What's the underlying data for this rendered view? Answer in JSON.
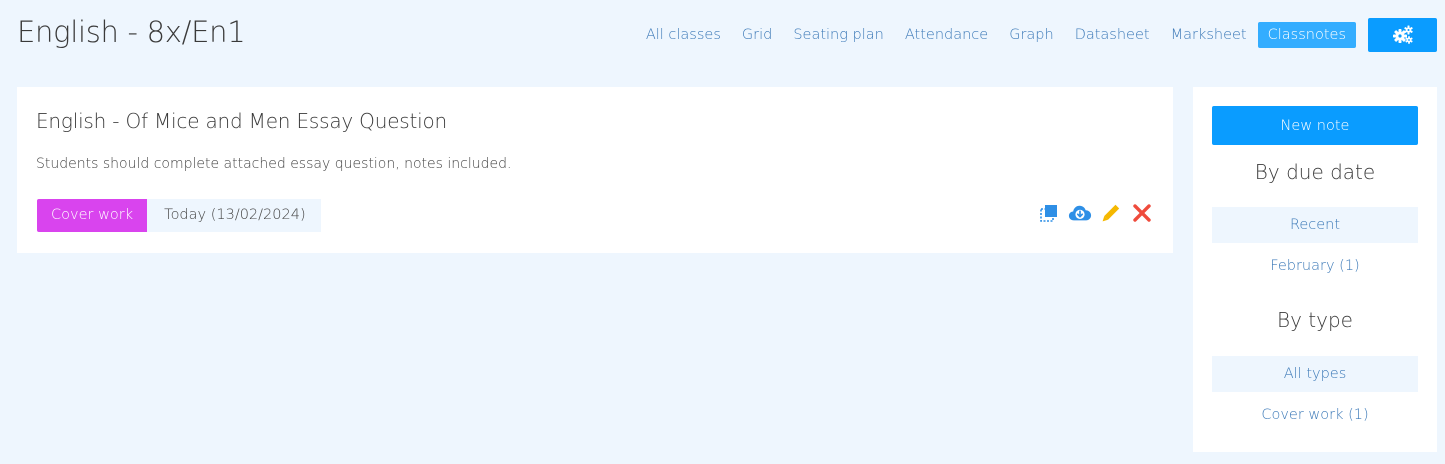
{
  "header": {
    "class_title": "English - 8x/En1",
    "nav": [
      {
        "label": "All classes"
      },
      {
        "label": "Grid"
      },
      {
        "label": "Seating plan"
      },
      {
        "label": "Attendance"
      },
      {
        "label": "Graph"
      },
      {
        "label": "Datasheet"
      },
      {
        "label": "Marksheet"
      },
      {
        "label": "Classnotes",
        "active": true
      }
    ],
    "settings_icon": "gears-icon"
  },
  "note": {
    "title": "English - Of Mice and Men Essay Question",
    "body": "Students should complete attached essay question, notes included.",
    "type_label": "Cover work",
    "date_label": "Today (13/02/2024)",
    "actions": [
      "copy-icon",
      "cloud-download-icon",
      "pencil-icon",
      "delete-icon"
    ]
  },
  "sidebar": {
    "new_note_label": "New note",
    "by_due_date_heading": "By due date",
    "due_filters": [
      {
        "label": "Recent",
        "selected": true
      },
      {
        "label": "February (1)",
        "selected": false
      }
    ],
    "by_type_heading": "By type",
    "type_filters": [
      {
        "label": "All types",
        "selected": true
      },
      {
        "label": "Cover work (1)",
        "selected": false
      }
    ]
  },
  "colors": {
    "background": "#eef6fe",
    "primary": "#0a9cff",
    "active_tab": "#33adff",
    "link": "#3d7ab8",
    "cover_work_badge": "#d944ee",
    "pencil": "#f5b800",
    "delete": "#ef4b3c"
  }
}
